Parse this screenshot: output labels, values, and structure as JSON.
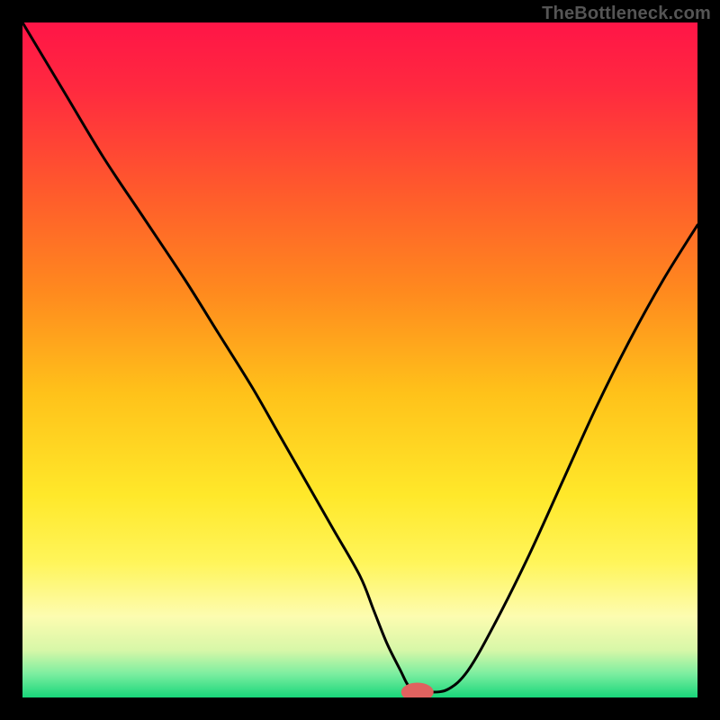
{
  "watermark": "TheBottleneck.com",
  "chart_data": {
    "type": "line",
    "title": "",
    "xlabel": "",
    "ylabel": "",
    "xlim": [
      0,
      100
    ],
    "ylim": [
      0,
      100
    ],
    "gradient_stops": [
      {
        "offset": 0.0,
        "color": "#ff1547"
      },
      {
        "offset": 0.1,
        "color": "#ff2a3f"
      },
      {
        "offset": 0.25,
        "color": "#ff5a2c"
      },
      {
        "offset": 0.4,
        "color": "#ff8a1e"
      },
      {
        "offset": 0.55,
        "color": "#ffc21a"
      },
      {
        "offset": 0.7,
        "color": "#ffe82a"
      },
      {
        "offset": 0.8,
        "color": "#fff55a"
      },
      {
        "offset": 0.88,
        "color": "#fdfcb0"
      },
      {
        "offset": 0.93,
        "color": "#d7f7a8"
      },
      {
        "offset": 0.965,
        "color": "#7ceea0"
      },
      {
        "offset": 1.0,
        "color": "#18d67a"
      }
    ],
    "series": [
      {
        "name": "bottleneck-curve",
        "x": [
          0,
          6,
          12,
          18,
          24,
          29,
          34,
          38,
          42,
          46,
          50,
          52,
          54,
          56,
          57,
          58,
          60,
          63,
          66,
          70,
          75,
          80,
          85,
          90,
          95,
          100
        ],
        "values": [
          100,
          90,
          80,
          71,
          62,
          54,
          46,
          39,
          32,
          25,
          18,
          13,
          8,
          4,
          2,
          1,
          0.8,
          1.2,
          4,
          11,
          21,
          32,
          43,
          53,
          62,
          70
        ]
      }
    ],
    "flat_bottom": {
      "x_start": 54,
      "x_end": 60,
      "y": 0.8
    },
    "marker": {
      "x": 58.5,
      "y": 0.8,
      "rx": 2.4,
      "ry": 1.4,
      "color": "#e0625f"
    }
  }
}
